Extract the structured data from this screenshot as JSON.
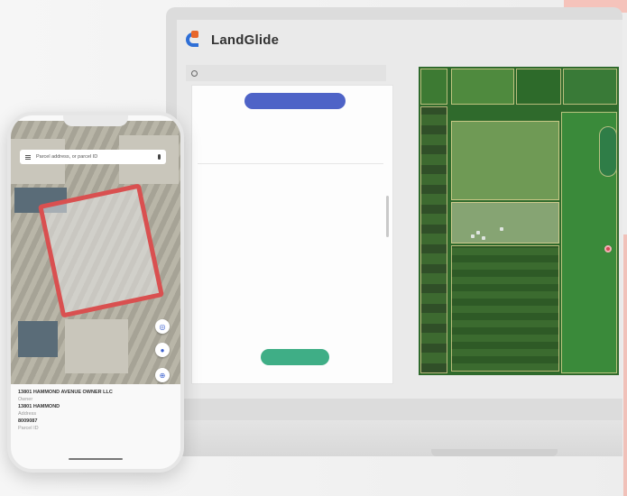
{
  "brand": {
    "name": "LandGlide",
    "colors": {
      "blue": "#2f6fd6",
      "orange": "#e8672b"
    }
  },
  "desktop": {
    "search": {
      "placeholder": ""
    },
    "panel": {
      "top_button": "",
      "fields": [
        {
          "key": "",
          "value": ""
        },
        {
          "key": "",
          "value": ""
        },
        {
          "key": "",
          "value": ""
        }
      ],
      "fields2": [
        {
          "key": "",
          "value": ""
        },
        {
          "key": "",
          "value": ""
        },
        {
          "key": "",
          "value": ""
        },
        {
          "key": "",
          "value": ""
        },
        {
          "key": "",
          "value": ""
        },
        {
          "key": "",
          "value": ""
        },
        {
          "key": "",
          "value": ""
        },
        {
          "key": "",
          "value": ""
        }
      ],
      "bottom_button": ""
    }
  },
  "phone": {
    "search": {
      "placeholder": "Parcel address, or parcel ID"
    },
    "info": {
      "owner": "13801 HAMMOND AVENUE OWNER LLC",
      "owner_label": "Owner",
      "address": "13801 HAMMOND",
      "address_label": "Address",
      "parcel_id": "8009087",
      "parcel_label": "Parcel ID"
    }
  }
}
